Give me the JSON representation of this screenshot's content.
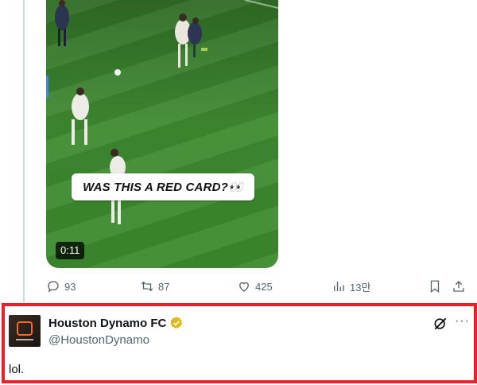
{
  "media": {
    "caption": "WAS THIS A RED CARD?👀",
    "duration": "0:11"
  },
  "actions": {
    "replies": "93",
    "reposts": "87",
    "likes": "425",
    "views": "13만"
  },
  "reply": {
    "display_name": "Houston Dynamo FC",
    "handle": "@HoustonDynamo",
    "text": "lol."
  },
  "colors": {
    "highlight_border": "#e8202a",
    "verified_badge": "#e2b719",
    "secondary_text": "#536471",
    "pitch": "#3b8a2e"
  },
  "icons": [
    "reply-icon",
    "repost-icon",
    "like-icon",
    "views-icon",
    "bookmark-icon",
    "share-icon",
    "verified-badge-icon",
    "grok-icon",
    "more-icon"
  ]
}
